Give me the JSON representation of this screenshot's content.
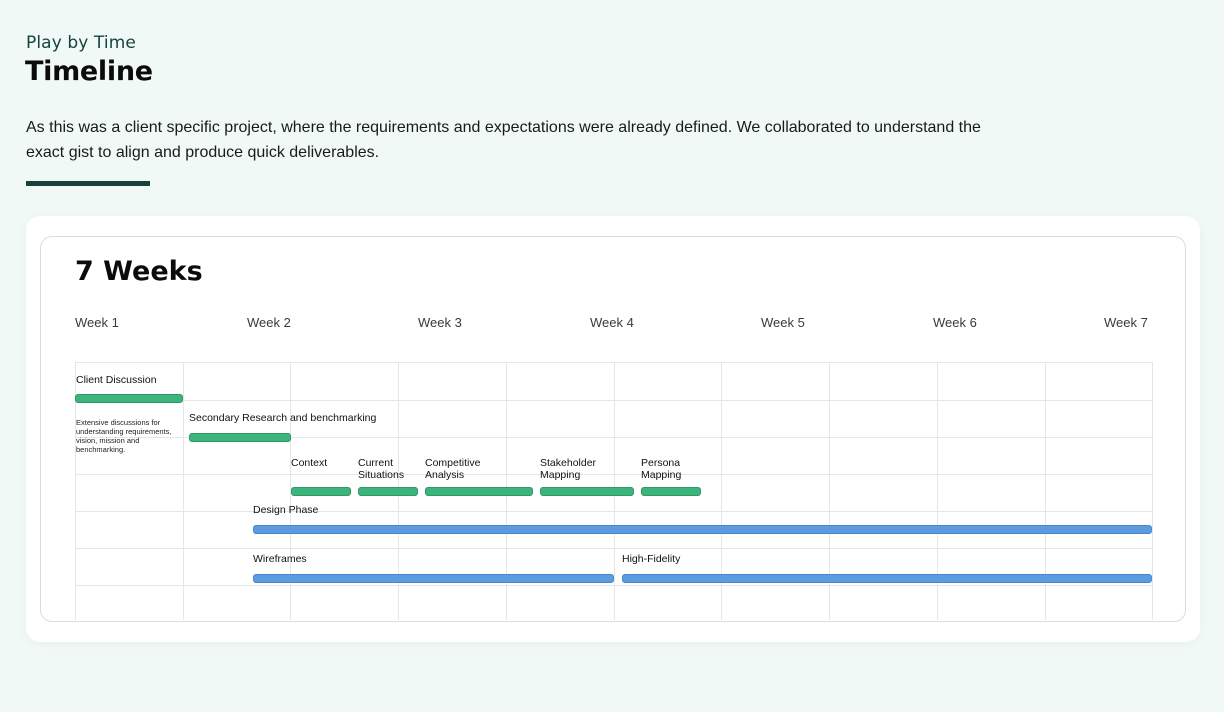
{
  "header": {
    "eyebrow": "Play by Time",
    "title": "Timeline",
    "description": "As this was a client specific project, where the requirements and expectations were already defined. We collaborated to understand the exact gist to align and produce quick deliverables."
  },
  "timeline": {
    "title": "7 Weeks",
    "weeks": [
      "Week 1",
      "Week 2",
      "Week 3",
      "Week 4",
      "Week 5",
      "Week 6",
      "Week 7"
    ],
    "tasks": {
      "client_discussion": {
        "label": "Client Discussion",
        "note": "Extensive discussions for understanding requirements, vision, mission and benchmarking."
      },
      "secondary_research": {
        "label": "Secondary Research and benchmarking"
      },
      "context": {
        "label": "Context"
      },
      "current_situations": {
        "label": "Current Situations"
      },
      "competitive_analysis": {
        "label": "Competitive Analysis"
      },
      "stakeholder_mapping": {
        "label": "Stakeholder Mapping"
      },
      "persona_mapping": {
        "label": "Persona Mapping"
      },
      "design_phase": {
        "label": "Design Phase"
      },
      "wireframes": {
        "label": "Wireframes"
      },
      "high_fidelity": {
        "label": "High-Fidelity"
      }
    },
    "colors": {
      "research": "#3cb47c",
      "design": "#5d9be0",
      "accent": "#16433d"
    }
  }
}
